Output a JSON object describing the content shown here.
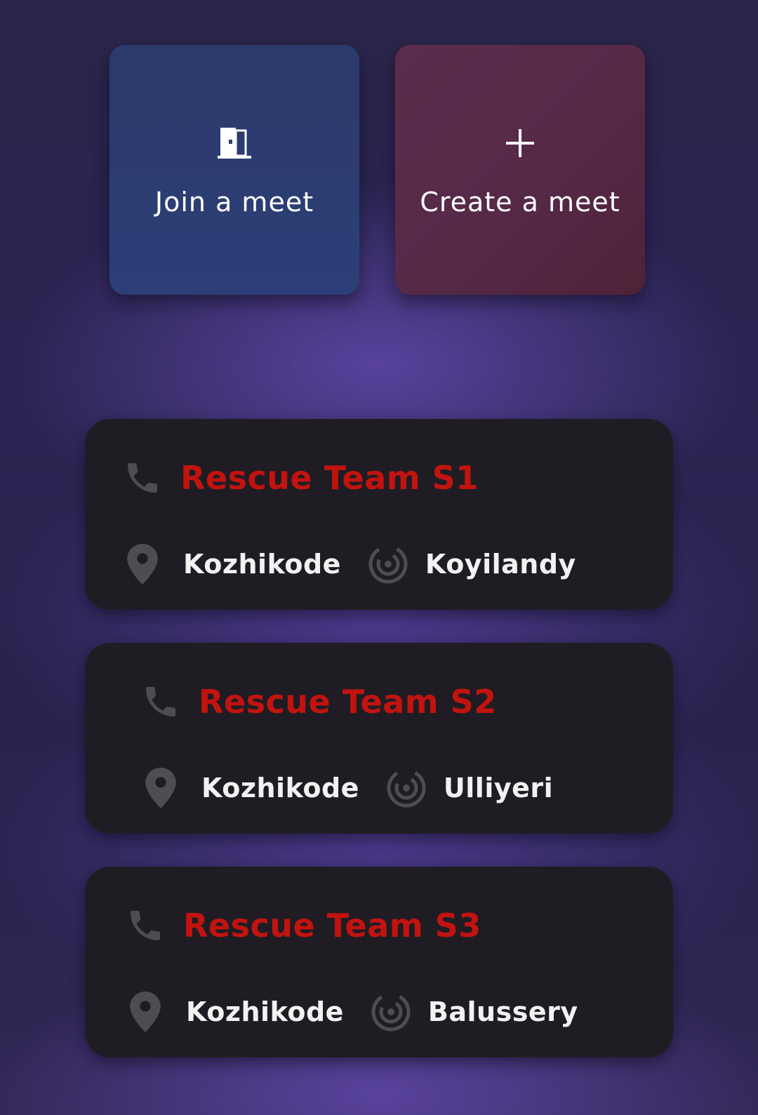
{
  "actions": {
    "join": {
      "label": "Join a meet",
      "icon": "door-icon"
    },
    "create": {
      "label": "Create a meet",
      "icon": "plus-icon"
    }
  },
  "teams": [
    {
      "name": "Rescue Team S1",
      "district": "Kozhikode",
      "area": "Koyilandy"
    },
    {
      "name": "Rescue Team S2",
      "district": "Kozhikode",
      "area": "Ulliyeri"
    },
    {
      "name": "Rescue Team S3",
      "district": "Kozhikode",
      "area": "Balussery"
    }
  ],
  "colors": {
    "title_red": "#c3130f",
    "card_bg": "#1f1d23",
    "icon_gray": "#4e4e50",
    "join_tile": "#2d3f78",
    "create_tile": "#552946"
  }
}
